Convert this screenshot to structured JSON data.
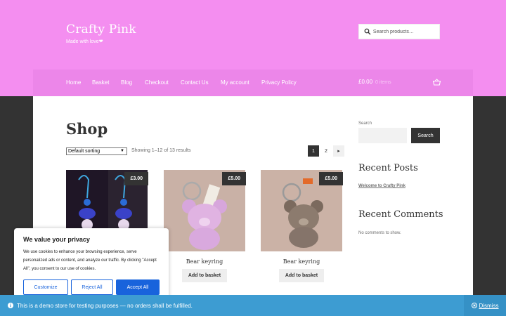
{
  "header": {
    "site_title": "Crafty Pink",
    "tagline": "Made with love❤",
    "search_placeholder": "Search products…"
  },
  "nav": {
    "items": [
      {
        "label": "Home"
      },
      {
        "label": "Basket"
      },
      {
        "label": "Blog"
      },
      {
        "label": "Checkout"
      },
      {
        "label": "Contact Us"
      },
      {
        "label": "My account"
      },
      {
        "label": "Privacy Policy"
      }
    ],
    "cart_total": "£0.00",
    "cart_count": "0 items"
  },
  "shop": {
    "title": "Shop",
    "sort_selected": "Default sorting",
    "result_count": "Showing 1–12 of 13 results",
    "pages": [
      "1",
      "2"
    ],
    "next_symbol": "▸"
  },
  "products": [
    {
      "price": "£3.00",
      "name": "",
      "button": ""
    },
    {
      "price": "£5.00",
      "name": "Bear keyring",
      "button": "Add to basket"
    },
    {
      "price": "£5.00",
      "name": "Bear keyring",
      "button": "Add to basket"
    }
  ],
  "sidebar": {
    "search_label": "Search",
    "search_button": "Search",
    "recent_posts_title": "Recent Posts",
    "recent_post_link": "Welcome to Crafty Pink",
    "recent_comments_title": "Recent Comments",
    "no_comments": "No comments to show."
  },
  "cookie": {
    "title": "We value your privacy",
    "text": "We use cookies to enhance your browsing experience, serve personalized ads or content, and analyze our traffic. By clicking \"Accept All\", you consent to our use of cookies.",
    "customize": "Customize",
    "reject": "Reject All",
    "accept": "Accept All"
  },
  "notice": {
    "text": "This is a demo store for testing purposes — no orders shall be fulfilled.",
    "dismiss": "Dismiss"
  },
  "colors": {
    "header_pink": "#f48ef0",
    "nav_pink": "#ec86e9",
    "notice_blue": "#3d9cd2",
    "cookie_blue": "#1863dc"
  }
}
